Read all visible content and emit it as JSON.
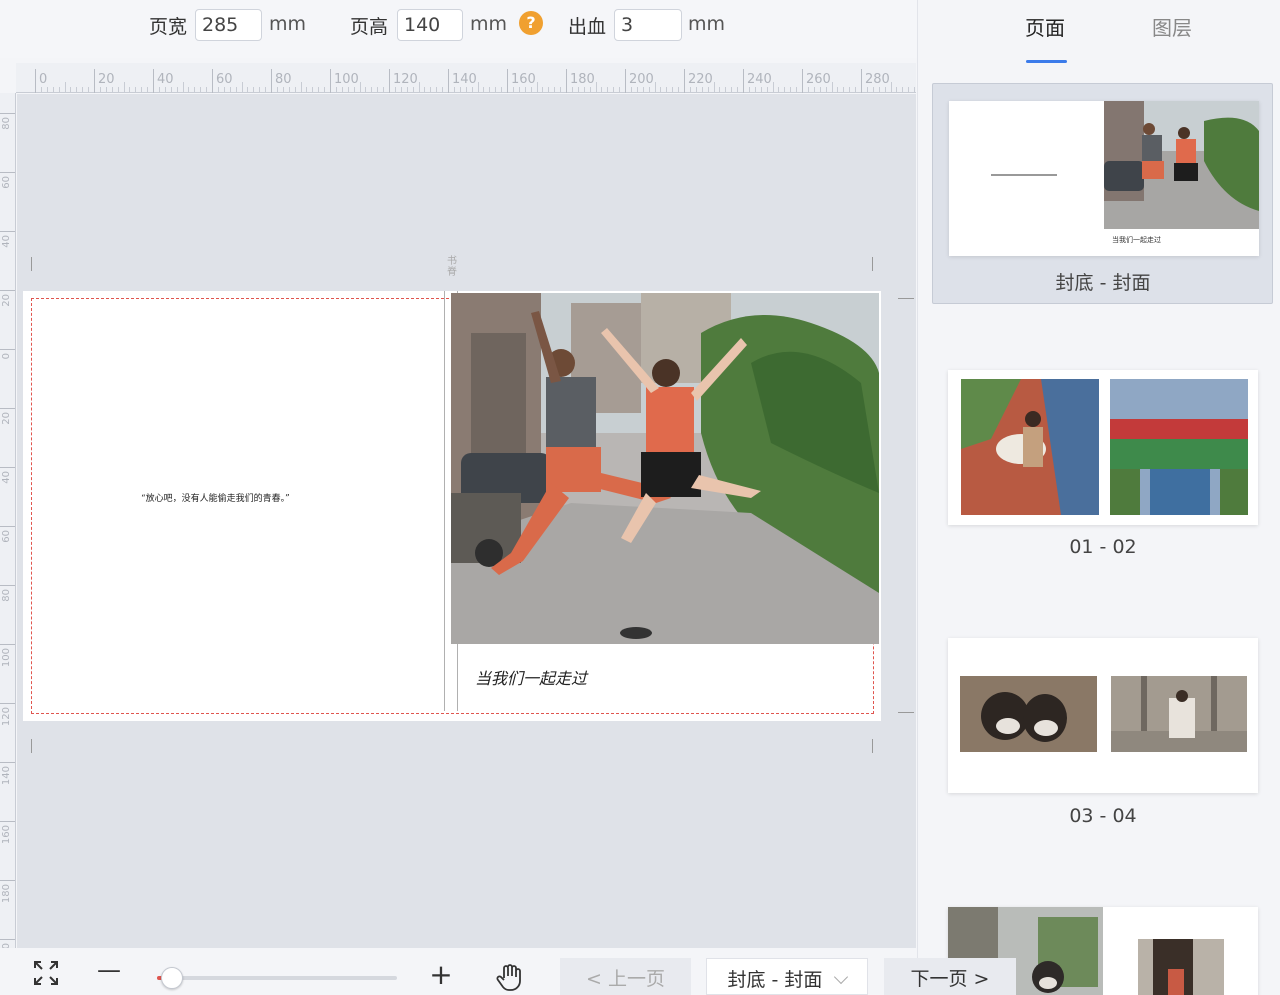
{
  "toolbar": {
    "page_width_label": "页宽",
    "page_width_value": "285",
    "page_height_label": "页高",
    "page_height_value": "140",
    "bleed_label": "出血",
    "bleed_value": "3",
    "unit": "mm",
    "help_glyph": "?"
  },
  "ruler": {
    "h_marks": [
      "0",
      "20",
      "40",
      "60",
      "80",
      "100",
      "120",
      "140",
      "160",
      "180",
      "200",
      "220",
      "240",
      "260",
      "280"
    ],
    "v_marks": [
      "80",
      "60",
      "40",
      "20",
      "0",
      "20",
      "40",
      "60",
      "80",
      "100",
      "120",
      "140",
      "160",
      "180",
      "200"
    ]
  },
  "canvas": {
    "spine_label": "书脊",
    "quote": "“放心吧，没有人能偷走我们的青春。”",
    "caption": "当我们一起走过"
  },
  "panel": {
    "tab_page": "页面",
    "tab_layer": "图层",
    "thumbs": [
      {
        "label": "封底 - 封面"
      },
      {
        "label": "01 - 02"
      },
      {
        "label": "03 - 04"
      }
    ],
    "thumb1_caption": "当我们一起走过"
  },
  "bottom": {
    "fit_icon": "expand-icon",
    "zoom_out": "—",
    "zoom_in": "+",
    "zoom_level": 0.02,
    "prev_label": "< 上一页",
    "page_select_label": "封底 - 封面",
    "next_label": "下一页 >"
  },
  "colors": {
    "accent": "#3b7bea",
    "bleed_line": "#e0554f",
    "help": "#f0a030"
  }
}
